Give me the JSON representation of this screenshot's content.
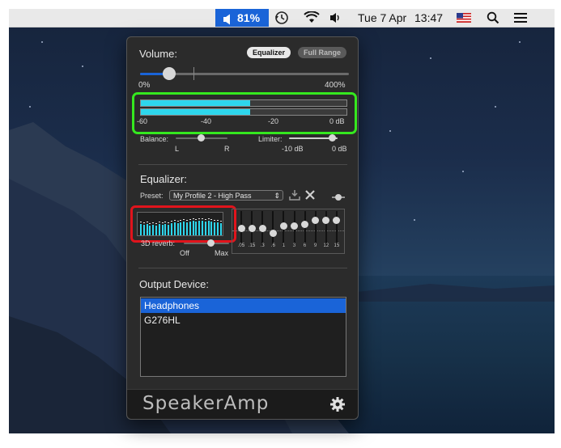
{
  "menubar": {
    "volume_percent": "81%",
    "date": "Tue 7 Apr",
    "time": "13:47",
    "icons": [
      "speaker-icon",
      "time-machine-icon",
      "wifi-icon",
      "volume-icon",
      "flag-icon",
      "search-icon",
      "list-icon"
    ]
  },
  "volume": {
    "title": "Volume:",
    "modes": [
      "Equalizer",
      "Full Range"
    ],
    "active_mode": "Equalizer",
    "min_label": "0%",
    "max_label": "400%",
    "level": 0.14
  },
  "meter": {
    "ticks": [
      "-60",
      "-40",
      "-20",
      "0 dB"
    ],
    "channels": [
      0.53,
      0.53
    ]
  },
  "balance": {
    "label": "Balance:",
    "left": "L",
    "right": "R",
    "position": 0.5
  },
  "limiter": {
    "label": "Limiter:",
    "min": "-10 dB",
    "max": "0 dB",
    "position": 0.92
  },
  "equalizer": {
    "title": "Equalizer:",
    "preset_label": "Preset:",
    "preset_value": "My Profile 2 - High Pass",
    "bands": [
      ".05",
      ".15",
      ".3",
      ".6",
      "1",
      "3",
      "6",
      "9",
      "12",
      "15"
    ],
    "band_levels": [
      0.52,
      0.52,
      0.52,
      0.38,
      0.58,
      0.58,
      0.63,
      0.75,
      0.75,
      0.75
    ],
    "reverb_label": "3D reverb:",
    "reverb_min": "Off",
    "reverb_max": "Max",
    "reverb_level": 0.6
  },
  "output": {
    "title": "Output Device:",
    "devices": [
      "Headphones",
      "G276HL"
    ],
    "selected": "Headphones"
  },
  "footer": {
    "brand": "SpeakerAmp"
  },
  "colors": {
    "accent": "#1a64d8",
    "meter": "#2ed6ec",
    "highlight_green": "#35e81f",
    "highlight_red": "#e1141c"
  }
}
